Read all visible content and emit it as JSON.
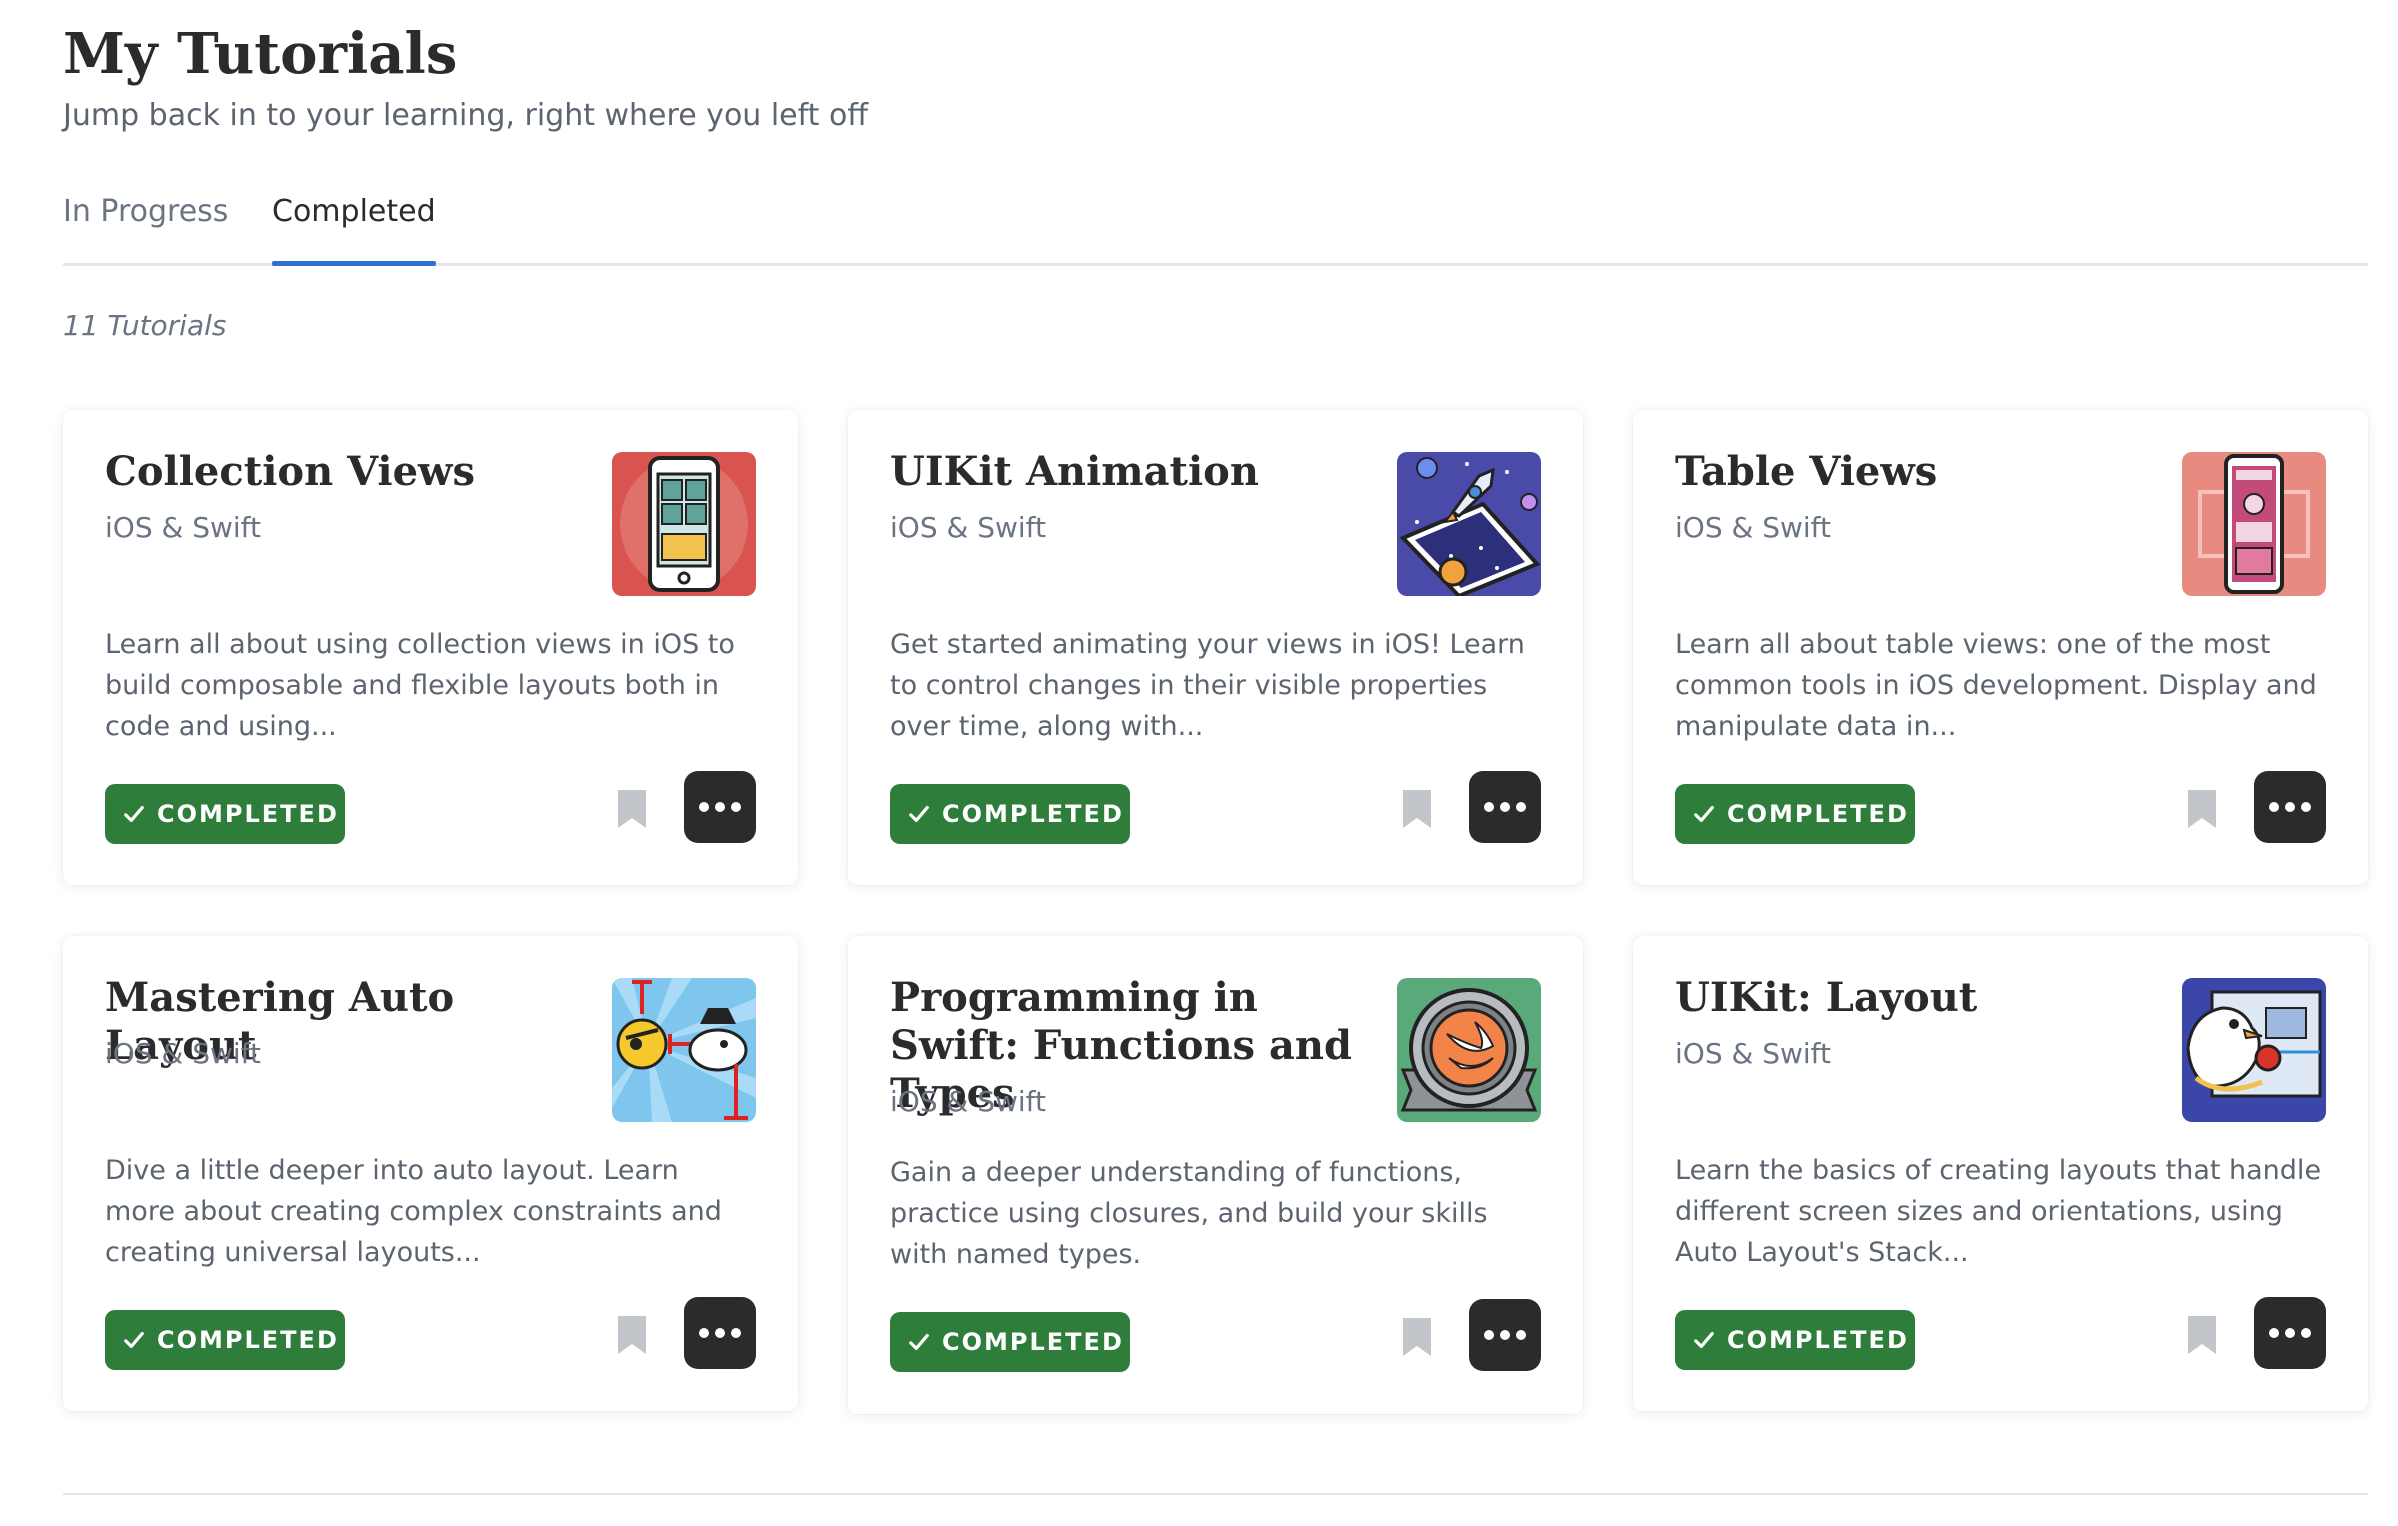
{
  "header": {
    "title": "My Tutorials",
    "subtitle": "Jump back in to your learning, right where you left off"
  },
  "tabs": [
    {
      "label": "In Progress",
      "active": false
    },
    {
      "label": "Completed",
      "active": true
    }
  ],
  "tutorial_count": "11 Tutorials",
  "colors": {
    "accent_tab": "#2f6fcf",
    "completed_badge": "#2e7d3a",
    "more_button": "#2b2b2b"
  },
  "cards": [
    {
      "title": "Collection Views",
      "category": "iOS & Swift",
      "description": "Learn all about using collection views in iOS to build composable and flexible layouts both in code and using...",
      "status": "COMPLETED",
      "thumbnail_icon": "phone-grid-illustration"
    },
    {
      "title": "UIKit Animation",
      "category": "iOS & Swift",
      "description": "Get started animating your views in iOS! Learn to control changes in their visible properties over time, along with...",
      "status": "COMPLETED",
      "thumbnail_icon": "rocket-phone-illustration"
    },
    {
      "title": "Table Views",
      "category": "iOS & Swift",
      "description": "Learn all about table views: one of the most common tools in iOS development. Display and manipulate data in...",
      "status": "COMPLETED",
      "thumbnail_icon": "phone-table-illustration"
    },
    {
      "title": "Mastering Auto Layout",
      "category": "iOS & Swift",
      "description": "Dive a little deeper into auto layout. Learn more about creating complex constraints and creating universal layouts...",
      "status": "COMPLETED",
      "thumbnail_icon": "pirate-sun-bird-illustration"
    },
    {
      "title": "Programming in Swift: Functions and Types",
      "category": "iOS & Swift",
      "description": "Gain a deeper understanding of functions, practice using closures, and build your skills with named types.",
      "status": "COMPLETED",
      "thumbnail_icon": "swift-medal-illustration"
    },
    {
      "title": "UIKit: Layout",
      "category": "iOS & Swift",
      "description": "Learn the basics of creating layouts that handle different screen sizes and orientations, using Auto Layout's Stack...",
      "status": "COMPLETED",
      "thumbnail_icon": "bird-layout-illustration"
    }
  ]
}
